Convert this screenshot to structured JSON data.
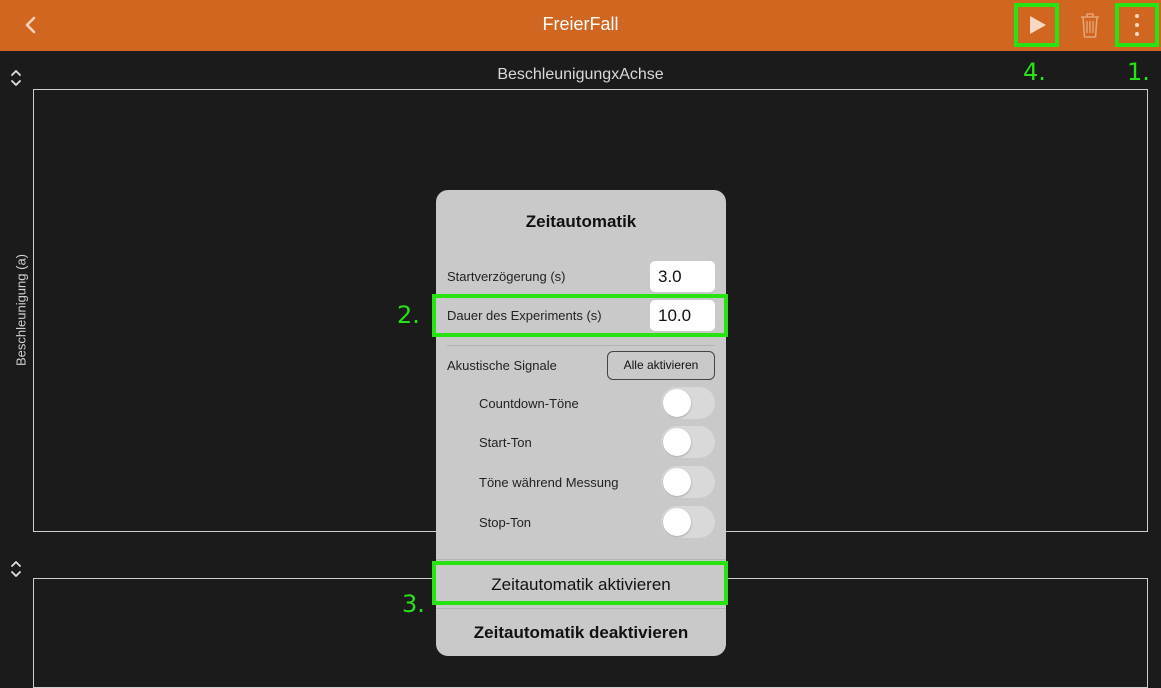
{
  "appbar": {
    "title": "FreierFall"
  },
  "chart": {
    "title": "BeschleunigungxAchse",
    "ylabel": "Beschleunigung (a)"
  },
  "dialog": {
    "title": "Zeitautomatik",
    "start_delay_label": "Startverzögerung (s)",
    "start_delay_value": "3.0",
    "duration_label": "Dauer des Experiments (s)",
    "duration_value": "10.0",
    "acoustic_label": "Akustische Signale",
    "enable_all_label": "Alle aktivieren",
    "toggles": [
      {
        "label": "Countdown-Töne",
        "on": false
      },
      {
        "label": "Start-Ton",
        "on": false
      },
      {
        "label": "Töne während Messung",
        "on": false
      },
      {
        "label": "Stop-Ton",
        "on": false
      }
    ],
    "activate_label": "Zeitautomatik aktivieren",
    "deactivate_label": "Zeitautomatik deaktivieren"
  },
  "annotations": {
    "one": "1.",
    "two": "2.",
    "three": "3.",
    "four": "4."
  },
  "colors": {
    "appbar": "#d0661f",
    "background": "#1b1b1b",
    "dialog": "#c9c9c9",
    "highlight": "#27e312"
  }
}
